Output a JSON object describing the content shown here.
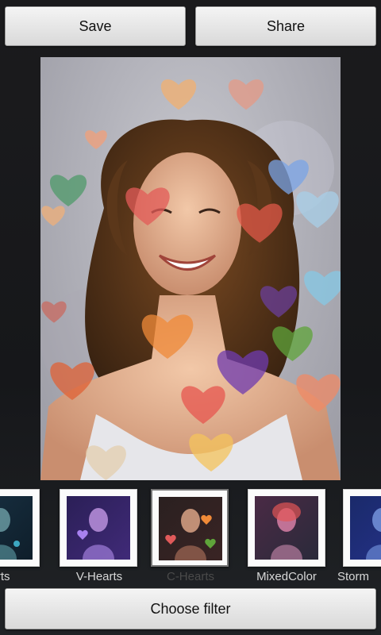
{
  "toolbar": {
    "save_label": "Save",
    "share_label": "Share"
  },
  "filters": [
    {
      "label": "arts",
      "tint": "#1d3a4f"
    },
    {
      "label": "V-Hearts",
      "tint": "#3b2e70"
    },
    {
      "label": "C-Hearts",
      "tint": "#3a2a2a",
      "selected": true
    },
    {
      "label": "MixedColor",
      "tint": "#5a2a4a"
    },
    {
      "label": "Storm",
      "tint": "#1c2f6b"
    }
  ],
  "bottom": {
    "choose_filter_label": "Choose filter"
  },
  "colors": {
    "button_bg": "#e6e6e6",
    "background": "#1b1b1d",
    "label_text": "#d8d8d8",
    "selected_label_text": "#4a4a4a"
  }
}
